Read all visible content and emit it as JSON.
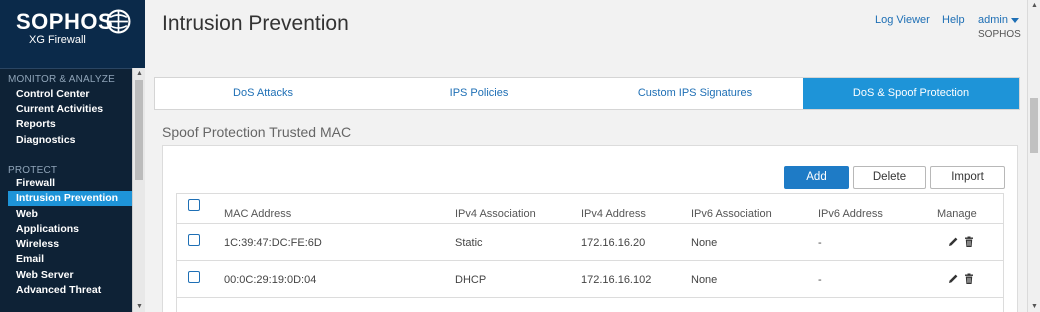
{
  "brand": {
    "name": "SOPHOS",
    "product": "XG Firewall"
  },
  "header": {
    "title": "Intrusion Prevention",
    "links": {
      "log_viewer": "Log Viewer",
      "help": "Help",
      "user": "admin"
    },
    "user_org": "SOPHOS"
  },
  "nav": {
    "monitor_section": "MONITOR & ANALYZE",
    "monitor_items": [
      "Control Center",
      "Current Activities",
      "Reports",
      "Diagnostics"
    ],
    "protect_section": "PROTECT",
    "protect_items": [
      "Firewall",
      "Intrusion Prevention",
      "Web",
      "Applications",
      "Wireless",
      "Email",
      "Web Server",
      "Advanced Threat"
    ],
    "active_item": "Intrusion Prevention"
  },
  "tabs": [
    {
      "label": "DoS Attacks",
      "active": false
    },
    {
      "label": "IPS Policies",
      "active": false
    },
    {
      "label": "Custom IPS Signatures",
      "active": false
    },
    {
      "label": "DoS & Spoof Protection",
      "active": true
    }
  ],
  "section": {
    "title": "Spoof Protection Trusted MAC"
  },
  "toolbar": {
    "add": "Add",
    "delete": "Delete",
    "import": "Import"
  },
  "table": {
    "columns": [
      "MAC Address",
      "IPv4 Association",
      "IPv4 Address",
      "IPv6 Association",
      "IPv6 Address",
      "Manage"
    ],
    "rows": [
      {
        "mac": "1C:39:47:DC:FE:6D",
        "ipv4_assoc": "Static",
        "ipv4": "172.16.16.20",
        "ipv6_assoc": "None",
        "ipv6": "-"
      },
      {
        "mac": "00:0C:29:19:0D:04",
        "ipv4_assoc": "DHCP",
        "ipv4": "172.16.16.102",
        "ipv6_assoc": "None",
        "ipv6": "-"
      }
    ]
  },
  "colors": {
    "sidebar_bg": "#0e2236",
    "accent": "#1e94d8",
    "primary_button": "#1e7bc6",
    "link": "#1e6fb5"
  },
  "icons": {
    "logo": "sophos-globe-icon",
    "edit": "pencil-icon",
    "delete": "trash-icon"
  }
}
